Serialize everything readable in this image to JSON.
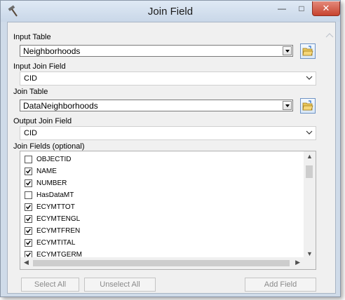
{
  "window": {
    "title": "Join Field"
  },
  "titlebar": {
    "minimize_label": "—",
    "maximize_label": "□",
    "close_label": "✕"
  },
  "input_table": {
    "label": "Input Table",
    "value": "Neighborhoods"
  },
  "input_join_field": {
    "label": "Input Join Field",
    "value": "CID"
  },
  "join_table": {
    "label": "Join Table",
    "value": "DataNeighborhoods"
  },
  "output_join_field": {
    "label": "Output Join Field",
    "value": "CID"
  },
  "join_fields": {
    "label": "Join Fields (optional)",
    "items": [
      {
        "name": "OBJECTID",
        "checked": false
      },
      {
        "name": "NAME",
        "checked": true
      },
      {
        "name": "NUMBER",
        "checked": true
      },
      {
        "name": "HasDataMT",
        "checked": false
      },
      {
        "name": "ECYMTTOT",
        "checked": true
      },
      {
        "name": "ECYMTENGL",
        "checked": true
      },
      {
        "name": "ECYMTFREN",
        "checked": true
      },
      {
        "name": "ECYMTITAL",
        "checked": true
      },
      {
        "name": "ECYMTGERM",
        "checked": true
      }
    ]
  },
  "buttons": {
    "select_all": "Select All",
    "unselect_all": "Unselect All",
    "add_field": "Add Field"
  }
}
